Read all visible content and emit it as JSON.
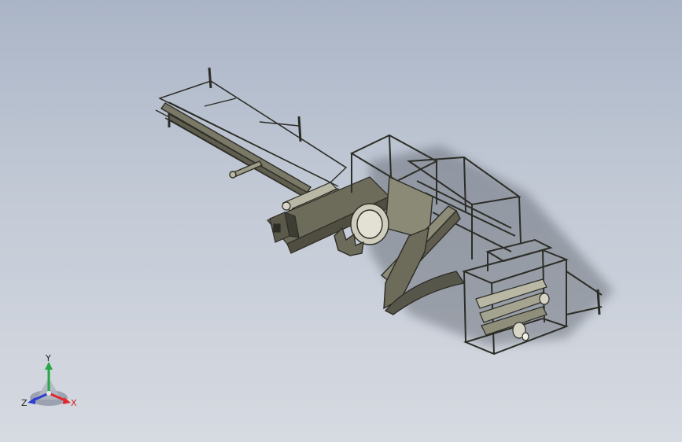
{
  "viewport": {
    "background_top": "#aab5c7",
    "background_bottom": "#d6dae1",
    "model_steel": "#6d6c5b",
    "model_edge": "#2d2d27",
    "model_light": "#b9b8a4"
  },
  "triad": {
    "x_label": "X",
    "y_label": "Y",
    "z_label": "Z",
    "x_color": "#e0282e",
    "y_color": "#27a745",
    "z_color": "#2b3fd1"
  }
}
